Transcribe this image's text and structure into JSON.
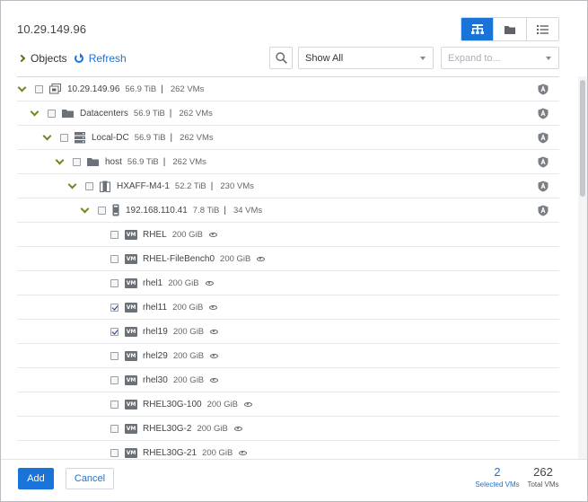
{
  "dialog": {
    "title": "10.29.149.96"
  },
  "view_toggle": {
    "active": "tree-view",
    "buttons": [
      {
        "name": "tree-view",
        "icon": "hierarchy-icon"
      },
      {
        "name": "folder-view",
        "icon": "folder-icon"
      },
      {
        "name": "list-view",
        "icon": "list-icon"
      }
    ]
  },
  "toolbar": {
    "objects_label": "Objects",
    "refresh_label": "Refresh",
    "filter_value": "Show All",
    "expand_placeholder": "Expand to..."
  },
  "tree": [
    {
      "name": "10.29.149.96",
      "size": "56.9 TiB",
      "sep": "|",
      "count": "262 VMs",
      "type": "vcenter",
      "expanded": true,
      "checked": false
    },
    {
      "name": "Datacenters",
      "size": "56.9 TiB",
      "sep": "|",
      "count": "262 VMs",
      "type": "folder",
      "expanded": true,
      "checked": false
    },
    {
      "name": "Local-DC",
      "size": "56.9 TiB",
      "sep": "|",
      "count": "262 VMs",
      "type": "datacenter",
      "expanded": true,
      "checked": false
    },
    {
      "name": "host",
      "size": "56.9 TiB",
      "sep": "|",
      "count": "262 VMs",
      "type": "folder",
      "expanded": true,
      "checked": false
    },
    {
      "name": "HXAFF-M4-1",
      "size": "52.2 TiB",
      "sep": "|",
      "count": "230 VMs",
      "type": "cluster",
      "expanded": true,
      "checked": false
    },
    {
      "name": "192.168.110.41",
      "size": "7.8 TiB",
      "sep": "|",
      "count": "34 VMs",
      "type": "host",
      "expanded": true,
      "checked": false
    },
    {
      "name": "RHEL",
      "size": "200 GiB",
      "type": "vm",
      "checked": false
    },
    {
      "name": "RHEL-FileBench0",
      "size": "200 GiB",
      "type": "vm",
      "checked": false
    },
    {
      "name": "rhel1",
      "size": "200 GiB",
      "type": "vm",
      "checked": false
    },
    {
      "name": "rhel11",
      "size": "200 GiB",
      "type": "vm",
      "checked": true
    },
    {
      "name": "rhel19",
      "size": "200 GiB",
      "type": "vm",
      "checked": true
    },
    {
      "name": "rhel29",
      "size": "200 GiB",
      "type": "vm",
      "checked": false
    },
    {
      "name": "rhel30",
      "size": "200 GiB",
      "type": "vm",
      "checked": false
    },
    {
      "name": "RHEL30G-100",
      "size": "200 GiB",
      "type": "vm",
      "checked": false
    },
    {
      "name": "RHEL30G-2",
      "size": "200 GiB",
      "type": "vm",
      "checked": false
    },
    {
      "name": "RHEL30G-21",
      "size": "200 GiB",
      "type": "vm",
      "checked": false
    }
  ],
  "vm_badge": "VM",
  "footer": {
    "add_label": "Add",
    "cancel_label": "Cancel",
    "selected_value": "2",
    "selected_label": "Selected VMs",
    "total_value": "262",
    "total_label": "Total VMs"
  },
  "colors": {
    "accent": "#1a73d8",
    "chevron": "#6a8a1f",
    "shield": "#7a7f85"
  }
}
